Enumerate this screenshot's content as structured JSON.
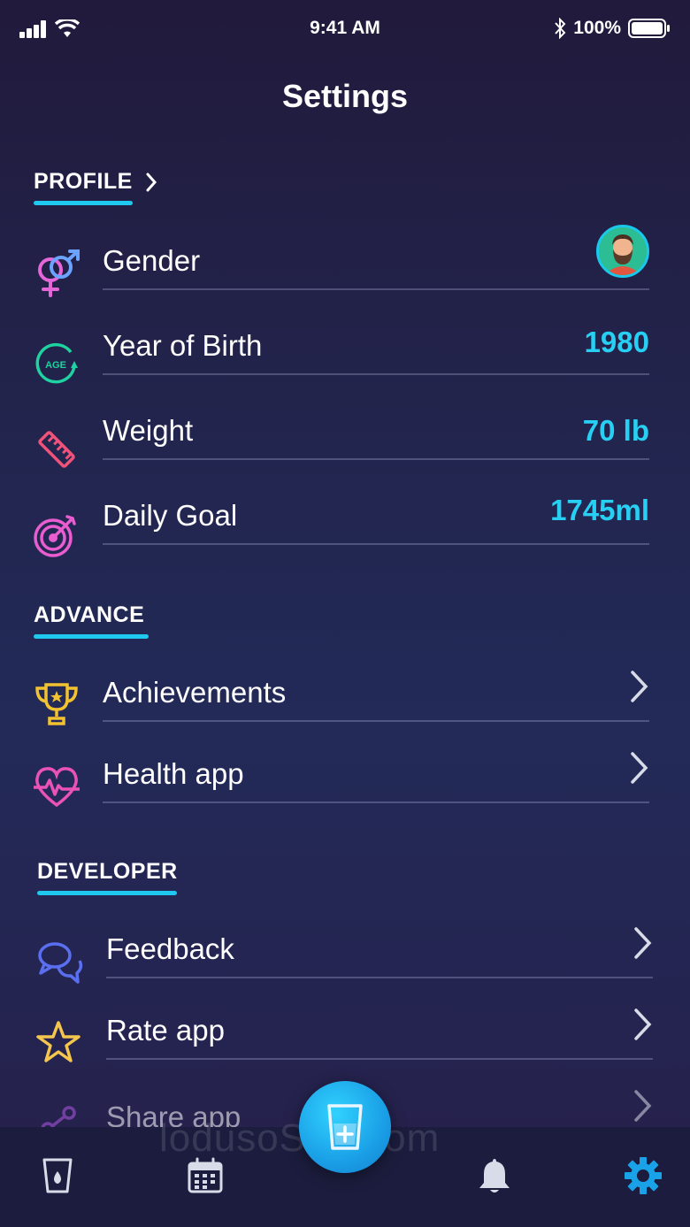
{
  "status": {
    "time": "9:41 AM",
    "battery": "100%",
    "icons": [
      "signal-icon",
      "wifi-icon",
      "bluetooth-icon",
      "battery-icon"
    ]
  },
  "title": "Settings",
  "sections": {
    "profile": {
      "title": "PROFILE",
      "rows": {
        "gender": {
          "label": "Gender",
          "icon": "gender-icon"
        },
        "birth": {
          "label": "Year of Birth",
          "value": "1980",
          "icon": "age-icon"
        },
        "weight": {
          "label": "Weight",
          "value": "70 lb",
          "icon": "ruler-icon"
        },
        "goal": {
          "label": "Daily Goal",
          "value": "1745ml",
          "icon": "target-icon"
        }
      }
    },
    "advance": {
      "title": "ADVANCE",
      "rows": {
        "achievements": {
          "label": "Achievements",
          "icon": "trophy-icon"
        },
        "health": {
          "label": "Health app",
          "icon": "heart-pulse-icon"
        }
      }
    },
    "developer": {
      "title": "DEVELOPER",
      "rows": {
        "feedback": {
          "label": "Feedback",
          "icon": "chat-icon"
        },
        "rate": {
          "label": "Rate app",
          "icon": "star-icon"
        },
        "share": {
          "label": "Share app",
          "icon": "share-icon"
        }
      }
    }
  },
  "tabbar": {
    "tabs": [
      "glass-icon",
      "calendar-icon",
      "add-water-icon",
      "bell-icon",
      "gear-icon"
    ],
    "active": "gear-icon"
  },
  "watermark": "lodusoSta .com",
  "colors": {
    "accent": "#1fc8ee",
    "value": "#27d0f2",
    "active_tab": "#1aa2e8"
  }
}
